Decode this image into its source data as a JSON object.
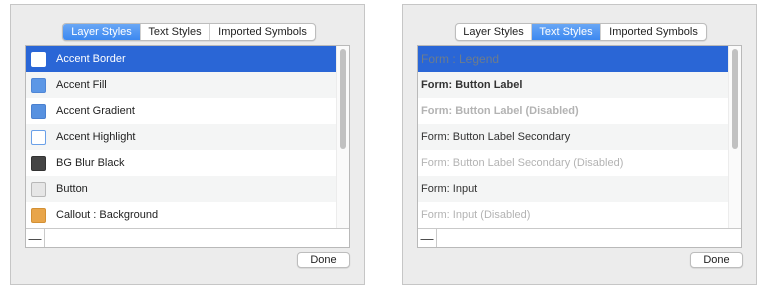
{
  "left_panel": {
    "tabs": [
      {
        "label": "Layer Styles",
        "active": true
      },
      {
        "label": "Text Styles",
        "active": false
      },
      {
        "label": "Imported Symbols",
        "active": false
      }
    ],
    "items": [
      {
        "label": "Accent Border",
        "swatch": "#ffffff",
        "swatch_border": "#ffffff",
        "selected": true
      },
      {
        "label": "Accent Fill",
        "swatch": "#5c97e6",
        "swatch_border": "#4f86d6"
      },
      {
        "label": "Accent Gradient",
        "swatch": "#5791e0",
        "swatch_border": "#4a80cf"
      },
      {
        "label": "Accent Highlight",
        "swatch": "#ffffff",
        "swatch_border": "#6aa0e8"
      },
      {
        "label": "BG Blur Black",
        "swatch": "#454545",
        "swatch_border": "#333333"
      },
      {
        "label": "Button",
        "swatch": "#e6e6e6",
        "swatch_border": "#b8b8b8"
      },
      {
        "label": "Callout : Background",
        "swatch": "#e8a54a",
        "swatch_border": "#d39034"
      }
    ],
    "remove_button": "—",
    "done_label": "Done"
  },
  "right_panel": {
    "tabs": [
      {
        "label": "Layer Styles",
        "active": false
      },
      {
        "label": "Text Styles",
        "active": true
      },
      {
        "label": "Imported Symbols",
        "active": false
      }
    ],
    "items": [
      {
        "label": "Form : Legend",
        "selected": true,
        "color": "#6d7c8c",
        "weight": "normal",
        "size": 12
      },
      {
        "label": "Form: Button Label",
        "color": "#333333",
        "weight": "bold",
        "size": 11
      },
      {
        "label": "Form: Button Label (Disabled)",
        "color": "#b3b3b3",
        "weight": "bold",
        "size": 11
      },
      {
        "label": "Form: Button Label Secondary",
        "color": "#333333",
        "weight": "normal",
        "size": 11
      },
      {
        "label": "Form: Button Label Secondary (Disabled)",
        "color": "#b3b3b3",
        "weight": "normal",
        "size": 11
      },
      {
        "label": "Form: Input",
        "color": "#333333",
        "weight": "normal",
        "size": 11
      },
      {
        "label": "Form: Input (Disabled)",
        "color": "#b3b3b3",
        "weight": "normal",
        "size": 11
      }
    ],
    "remove_button": "—",
    "done_label": "Done"
  },
  "colors": {
    "selection": "#2a66d6",
    "tab_active": "#3c88f0"
  }
}
